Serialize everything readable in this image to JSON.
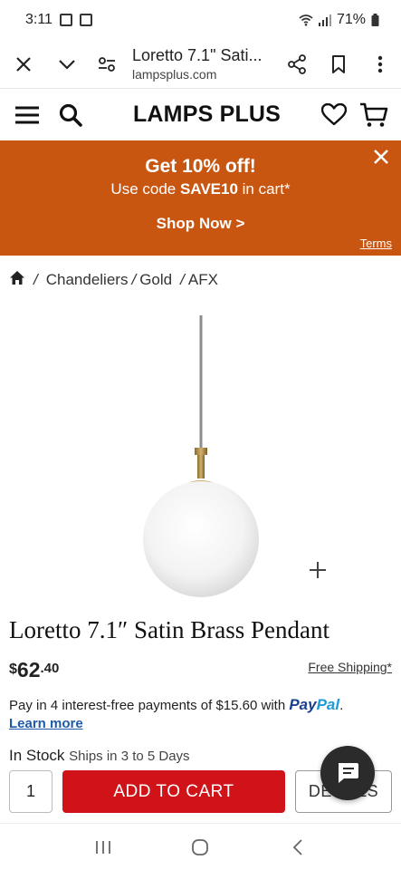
{
  "status_bar": {
    "time": "3:11",
    "battery": "71%"
  },
  "browser": {
    "page_title": "Loretto 7.1\" Sati...",
    "domain": "lampsplus.com"
  },
  "site": {
    "logo": "LAMPS PLUS"
  },
  "promo": {
    "title": "Get 10% off!",
    "sub_prefix": "Use code ",
    "code": "SAVE10",
    "sub_suffix": " in cart*",
    "cta": "Shop Now >",
    "terms": "Terms",
    "background": "#c85610"
  },
  "breadcrumb": {
    "items": [
      "Chandeliers",
      "Gold",
      "AFX"
    ],
    "separator": "/"
  },
  "product": {
    "title": "Loretto 7.1″ Satin Brass Pendant",
    "price_currency": "$",
    "price_dollars": "62",
    "price_cents": ".40",
    "free_shipping": "Free Shipping*",
    "paypal_text": "Pay in 4 interest-free payments of $15.60 with",
    "paypal_logo_1": "Pay",
    "paypal_logo_2": "Pal",
    "paypal_period": ".",
    "learn_more": "Learn more",
    "stock_status": "In Stock",
    "ships": "Ships in 3 to 5 Days",
    "quantity": "1",
    "add_to_cart": "ADD TO CART",
    "details": "DETAILS"
  },
  "colors": {
    "accent_red": "#cf1319",
    "promo_orange": "#c85610",
    "link_blue": "#1e5aa8"
  }
}
